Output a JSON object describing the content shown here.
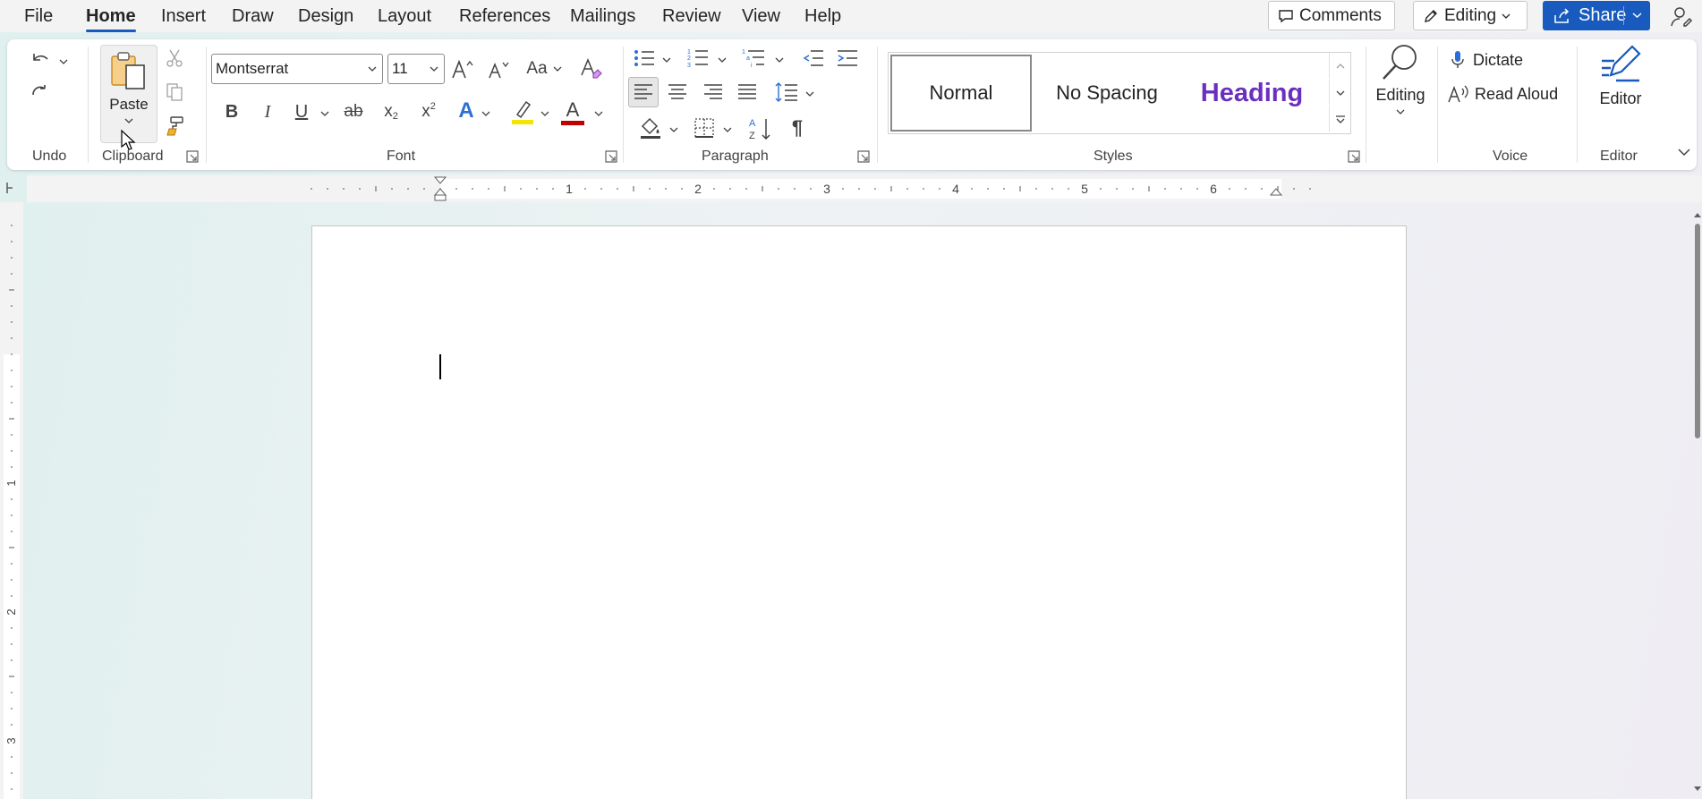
{
  "menu": {
    "tabs": [
      {
        "label": "File",
        "active": false
      },
      {
        "label": "Home",
        "active": true
      },
      {
        "label": "Insert",
        "active": false
      },
      {
        "label": "Draw",
        "active": false
      },
      {
        "label": "Design",
        "active": false
      },
      {
        "label": "Layout",
        "active": false
      },
      {
        "label": "References",
        "active": false
      },
      {
        "label": "Mailings",
        "active": false
      },
      {
        "label": "Review",
        "active": false
      },
      {
        "label": "View",
        "active": false
      },
      {
        "label": "Help",
        "active": false
      }
    ],
    "comments_label": "Comments",
    "editing_mode_label": "Editing",
    "share_label": "Share"
  },
  "ribbon": {
    "undo": {
      "group_label": "Undo"
    },
    "clipboard": {
      "group_label": "Clipboard",
      "paste_label": "Paste"
    },
    "font": {
      "group_label": "Font",
      "font_name": "Montserrat",
      "font_size": "11",
      "case_label": "Aa",
      "bold_label": "B",
      "italic_label": "I",
      "underline_label": "U",
      "strike_label": "ab",
      "subscript_label": "x",
      "superscript_label": "x",
      "text_effects_label": "A",
      "font_color_label": "A",
      "highlight_color": "#f5e400",
      "font_color": "#c00000"
    },
    "paragraph": {
      "group_label": "Paragraph"
    },
    "styles": {
      "group_label": "Styles",
      "items": [
        {
          "label": "Normal",
          "selected": true
        },
        {
          "label": "No Spacing",
          "selected": false
        },
        {
          "label": "Heading",
          "selected": false
        }
      ],
      "heading_color": "#6b2fbf"
    },
    "editing": {
      "label": "Editing"
    },
    "voice": {
      "group_label": "Voice",
      "dictate_label": "Dictate",
      "read_aloud_label": "Read Aloud"
    },
    "editor": {
      "group_label": "Editor",
      "label": "Editor"
    }
  },
  "ruler": {
    "numbers": [
      "1",
      "2",
      "3",
      "4",
      "5",
      "6"
    ],
    "vertical_numbers": [
      "1",
      "2",
      "3"
    ]
  },
  "colors": {
    "accent": "#185abd",
    "ribbon_bg": "#ffffff",
    "menubar_bg": "#f3f3f3"
  }
}
